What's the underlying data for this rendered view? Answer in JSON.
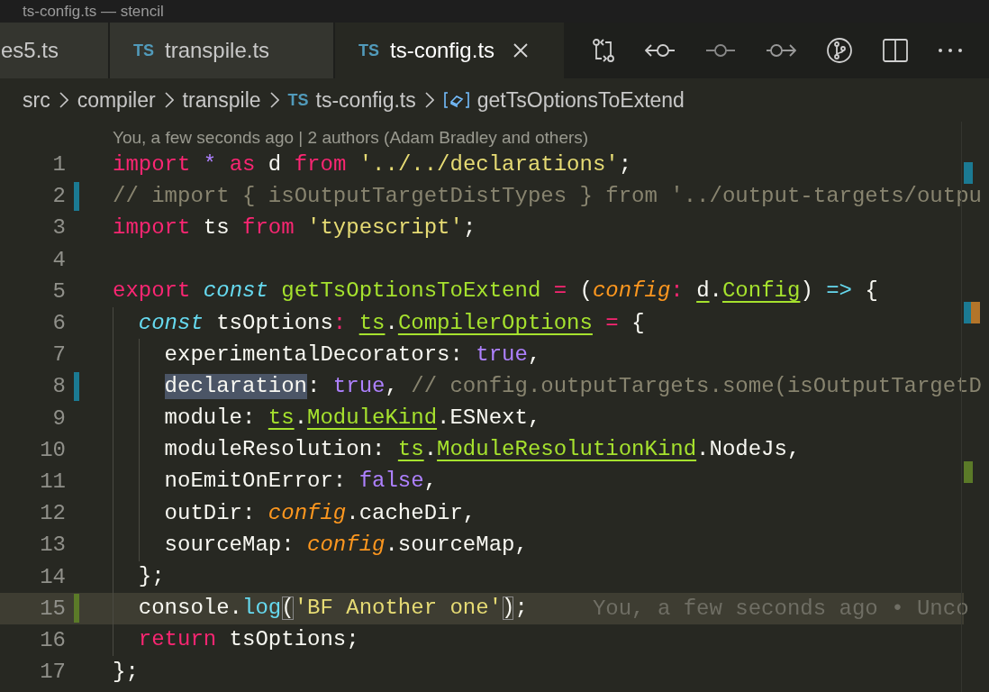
{
  "window": {
    "title": "ts-config.ts — stencil"
  },
  "tabs": [
    {
      "label": "es5.ts",
      "selected": false
    },
    {
      "icon_text": "TS",
      "label": "transpile.ts",
      "selected": false
    },
    {
      "icon_text": "TS",
      "label": "ts-config.ts",
      "selected": true
    }
  ],
  "breadcrumb": [
    {
      "kind": "folder",
      "label": "src"
    },
    {
      "kind": "folder",
      "label": "compiler"
    },
    {
      "kind": "folder",
      "label": "transpile"
    },
    {
      "kind": "file",
      "icon_text": "TS",
      "label": "ts-config.ts"
    },
    {
      "kind": "symbol",
      "label": "getTsOptionsToExtend"
    }
  ],
  "codelens": "You, a few seconds ago | 2 authors (Adam Bradley and others)",
  "lines": [
    {
      "number": "1",
      "modified": false,
      "added": false,
      "current": false,
      "tokens": [
        {
          "t": "import",
          "kind": "keyword"
        },
        {
          "t": " *",
          "kind": "constant"
        },
        {
          "t": " as",
          "kind": "keyword"
        },
        {
          "t": " d",
          "kind": "plain"
        },
        {
          "t": " from",
          "kind": "keyword"
        },
        {
          "t": " '../../declarations'",
          "kind": "string"
        },
        {
          "t": ";",
          "kind": "plain"
        }
      ]
    },
    {
      "number": "2",
      "modified": true,
      "added": false,
      "current": false,
      "tokens": [
        {
          "t": "// import { isOutputTargetDistTypes } from '../output-targets/outpu",
          "kind": "comment"
        }
      ]
    },
    {
      "number": "3",
      "modified": false,
      "added": false,
      "current": false,
      "tokens": [
        {
          "t": "import",
          "kind": "keyword"
        },
        {
          "t": " ts",
          "kind": "plain"
        },
        {
          "t": " from",
          "kind": "keyword"
        },
        {
          "t": " 'typescript'",
          "kind": "string"
        },
        {
          "t": ";",
          "kind": "plain"
        }
      ]
    },
    {
      "number": "4",
      "modified": false,
      "added": false,
      "current": false
    },
    {
      "number": "5",
      "modified": false,
      "added": false,
      "current": false,
      "tokens": [
        {
          "t": "export",
          "kind": "keyword"
        },
        {
          "t": " const",
          "kind": "storage"
        },
        {
          "t": " getTsOptionsToExtend",
          "kind": "func"
        },
        {
          "t": " =",
          "kind": "operator"
        },
        {
          "t": " (",
          "kind": "plain"
        },
        {
          "t": "config",
          "kind": "param"
        },
        {
          "t": ": ",
          "kind": "operator"
        },
        {
          "t": "d",
          "kind": "ns"
        },
        {
          "t": ".",
          "kind": "plain"
        },
        {
          "t": "Config",
          "kind": "type"
        },
        {
          "t": ")",
          "kind": "plain"
        },
        {
          "t": " =>",
          "kind": "arrow"
        },
        {
          "t": " {",
          "kind": "plain"
        }
      ]
    },
    {
      "number": "6",
      "modified": false,
      "added": false,
      "current": false,
      "tokens": [
        {
          "t": "  const",
          "kind": "storage"
        },
        {
          "t": " tsOptions",
          "kind": "plain"
        },
        {
          "t": ": ",
          "kind": "operator"
        },
        {
          "t": "ts",
          "kind": "type"
        },
        {
          "t": ".",
          "kind": "plain"
        },
        {
          "t": "CompilerOptions",
          "kind": "type"
        },
        {
          "t": " =",
          "kind": "operator"
        },
        {
          "t": " {",
          "kind": "plain"
        }
      ]
    },
    {
      "number": "7",
      "modified": false,
      "added": false,
      "current": false,
      "tokens": [
        {
          "t": "    experimentalDecorators:",
          "kind": "plain"
        },
        {
          "t": " true",
          "kind": "constant"
        },
        {
          "t": ",",
          "kind": "plain"
        }
      ]
    },
    {
      "number": "8",
      "modified": true,
      "added": false,
      "current": false,
      "tokens": [
        {
          "t": "    declaration",
          "kind": "match"
        },
        {
          "t": ":",
          "kind": "plain"
        },
        {
          "t": " true",
          "kind": "constant"
        },
        {
          "t": ",",
          "kind": "plain"
        },
        {
          "t": " // config.outputTargets.some(isOutputTargetD",
          "kind": "comment"
        }
      ]
    },
    {
      "number": "9",
      "modified": false,
      "added": false,
      "current": false,
      "tokens": [
        {
          "t": "    module: ",
          "kind": "plain"
        },
        {
          "t": "ts",
          "kind": "type"
        },
        {
          "t": ".",
          "kind": "plain"
        },
        {
          "t": "ModuleKind",
          "kind": "type"
        },
        {
          "t": ".ESNext,",
          "kind": "plain"
        }
      ]
    },
    {
      "number": "10",
      "modified": false,
      "added": false,
      "current": false,
      "tokens": [
        {
          "t": "    moduleResolution: ",
          "kind": "plain"
        },
        {
          "t": "ts",
          "kind": "type"
        },
        {
          "t": ".",
          "kind": "plain"
        },
        {
          "t": "ModuleResolutionKind",
          "kind": "type"
        },
        {
          "t": ".NodeJs,",
          "kind": "plain"
        }
      ]
    },
    {
      "number": "11",
      "modified": false,
      "added": false,
      "current": false,
      "tokens": [
        {
          "t": "    noEmitOnError:",
          "kind": "plain"
        },
        {
          "t": " false",
          "kind": "constant"
        },
        {
          "t": ",",
          "kind": "plain"
        }
      ]
    },
    {
      "number": "12",
      "modified": false,
      "added": false,
      "current": false,
      "tokens": [
        {
          "t": "    outDir:",
          "kind": "plain"
        },
        {
          "t": " config",
          "kind": "param"
        },
        {
          "t": ".cacheDir,",
          "kind": "plain"
        }
      ]
    },
    {
      "number": "13",
      "modified": false,
      "added": false,
      "current": false,
      "tokens": [
        {
          "t": "    sourceMap:",
          "kind": "plain"
        },
        {
          "t": " config",
          "kind": "param"
        },
        {
          "t": ".sourceMap,",
          "kind": "plain"
        }
      ]
    },
    {
      "number": "14",
      "modified": false,
      "added": false,
      "current": false,
      "tokens": [
        {
          "t": "  };",
          "kind": "plain"
        }
      ]
    },
    {
      "number": "15",
      "modified": false,
      "added": true,
      "current": true,
      "blame": "You, a few seconds ago • Unco",
      "tokens": [
        {
          "t": "  console.",
          "kind": "plain"
        },
        {
          "t": "log",
          "kind": "call"
        },
        {
          "t": "(",
          "kind": "bracket"
        },
        {
          "t": "'BF Another one'",
          "kind": "string"
        },
        {
          "t": ")",
          "kind": "bracket"
        },
        {
          "t": ";",
          "kind": "plain"
        }
      ]
    },
    {
      "number": "16",
      "modified": false,
      "added": false,
      "current": false,
      "tokens": [
        {
          "t": "  return",
          "kind": "keyword"
        },
        {
          "t": " tsOptions;",
          "kind": "plain"
        }
      ]
    },
    {
      "number": "17",
      "modified": false,
      "added": false,
      "current": false,
      "tokens": [
        {
          "t": "};",
          "kind": "plain"
        }
      ]
    }
  ]
}
